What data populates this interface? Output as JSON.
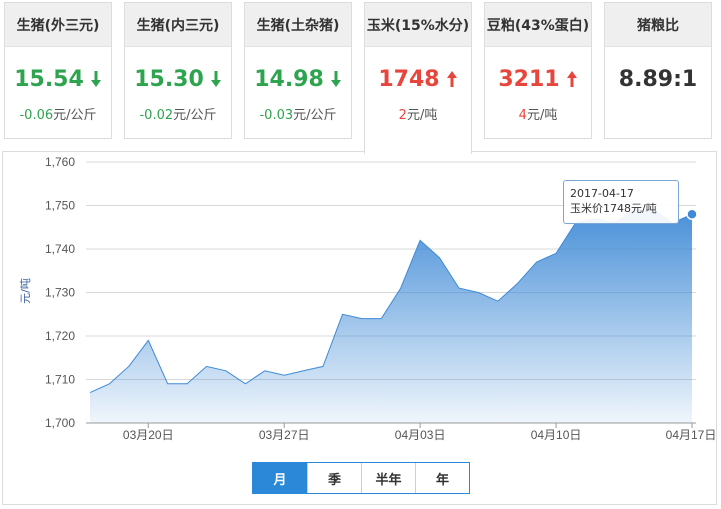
{
  "cards": [
    {
      "title": "生猪(外三元)",
      "value": "15.54",
      "direction": "down",
      "change": "-0.06",
      "unit": "元/公斤",
      "color": "#2ea44f"
    },
    {
      "title": "生猪(内三元)",
      "value": "15.30",
      "direction": "down",
      "change": "-0.02",
      "unit": "元/公斤",
      "color": "#2ea44f"
    },
    {
      "title": "生猪(土杂猪)",
      "value": "14.98",
      "direction": "down",
      "change": "-0.03",
      "unit": "元/公斤",
      "color": "#2ea44f"
    },
    {
      "title": "玉米(15%水分)",
      "value": "1748",
      "direction": "up",
      "change": "2",
      "unit": "元/吨",
      "color": "#e8453c"
    },
    {
      "title": "豆粕(43%蛋白)",
      "value": "3211",
      "direction": "up",
      "change": "4",
      "unit": "元/吨",
      "color": "#e8453c"
    },
    {
      "title": "猪粮比",
      "value": "8.89:1",
      "direction": "none",
      "change": "",
      "unit": "",
      "color": "#333333"
    }
  ],
  "active_card": 3,
  "tooltip": {
    "date": "2017-04-17",
    "text": "玉米价1748元/吨"
  },
  "range_buttons": [
    {
      "label": "月",
      "active": true
    },
    {
      "label": "季",
      "active": false
    },
    {
      "label": "半年",
      "active": false
    },
    {
      "label": "年",
      "active": false
    }
  ],
  "chart_data": {
    "type": "area",
    "ylabel": "元/吨",
    "ylim": [
      1700,
      1760
    ],
    "yticks": [
      1700,
      1710,
      1720,
      1730,
      1740,
      1750,
      1760
    ],
    "ytick_labels": [
      "1,700",
      "1,710",
      "1,720",
      "1,730",
      "1,740",
      "1,750",
      "1,760"
    ],
    "xtick_labels": [
      "03月20日",
      "03月27日",
      "04月03日",
      "04月10日",
      "04月17日"
    ],
    "x": [
      "03-17",
      "03-18",
      "03-19",
      "03-20",
      "03-21",
      "03-22",
      "03-23",
      "03-24",
      "03-25",
      "03-26",
      "03-27",
      "03-28",
      "03-29",
      "03-30",
      "03-31",
      "04-01",
      "04-02",
      "04-03",
      "04-04",
      "04-05",
      "04-06",
      "04-07",
      "04-08",
      "04-09",
      "04-10",
      "04-11",
      "04-12",
      "04-13",
      "04-14",
      "04-15",
      "04-16",
      "04-17"
    ],
    "values": [
      1707,
      1709,
      1713,
      1719,
      1709,
      1709,
      1713,
      1712,
      1709,
      1712,
      1711,
      1712,
      1713,
      1725,
      1724,
      1724,
      1731,
      1742,
      1738,
      1731,
      1730,
      1728,
      1732,
      1737,
      1739,
      1746,
      1747,
      1746,
      1749,
      1749,
      1746,
      1748
    ],
    "series_color": "#3f8ad6",
    "grid": true
  }
}
